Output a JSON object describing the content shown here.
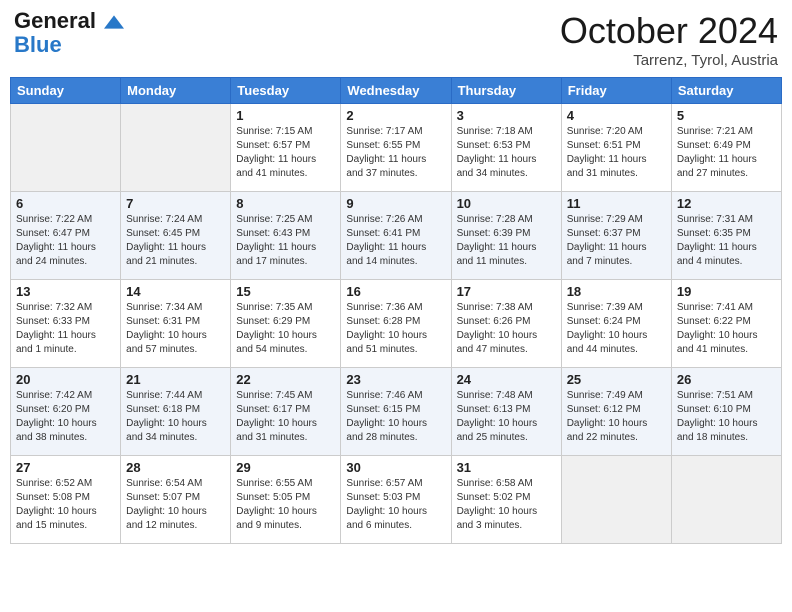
{
  "header": {
    "logo_general": "General",
    "logo_blue": "Blue",
    "month_title": "October 2024",
    "location": "Tarrenz, Tyrol, Austria"
  },
  "days_of_week": [
    "Sunday",
    "Monday",
    "Tuesday",
    "Wednesday",
    "Thursday",
    "Friday",
    "Saturday"
  ],
  "weeks": [
    [
      {
        "day": "",
        "info": ""
      },
      {
        "day": "",
        "info": ""
      },
      {
        "day": "1",
        "info": "Sunrise: 7:15 AM\nSunset: 6:57 PM\nDaylight: 11 hours and 41 minutes."
      },
      {
        "day": "2",
        "info": "Sunrise: 7:17 AM\nSunset: 6:55 PM\nDaylight: 11 hours and 37 minutes."
      },
      {
        "day": "3",
        "info": "Sunrise: 7:18 AM\nSunset: 6:53 PM\nDaylight: 11 hours and 34 minutes."
      },
      {
        "day": "4",
        "info": "Sunrise: 7:20 AM\nSunset: 6:51 PM\nDaylight: 11 hours and 31 minutes."
      },
      {
        "day": "5",
        "info": "Sunrise: 7:21 AM\nSunset: 6:49 PM\nDaylight: 11 hours and 27 minutes."
      }
    ],
    [
      {
        "day": "6",
        "info": "Sunrise: 7:22 AM\nSunset: 6:47 PM\nDaylight: 11 hours and 24 minutes."
      },
      {
        "day": "7",
        "info": "Sunrise: 7:24 AM\nSunset: 6:45 PM\nDaylight: 11 hours and 21 minutes."
      },
      {
        "day": "8",
        "info": "Sunrise: 7:25 AM\nSunset: 6:43 PM\nDaylight: 11 hours and 17 minutes."
      },
      {
        "day": "9",
        "info": "Sunrise: 7:26 AM\nSunset: 6:41 PM\nDaylight: 11 hours and 14 minutes."
      },
      {
        "day": "10",
        "info": "Sunrise: 7:28 AM\nSunset: 6:39 PM\nDaylight: 11 hours and 11 minutes."
      },
      {
        "day": "11",
        "info": "Sunrise: 7:29 AM\nSunset: 6:37 PM\nDaylight: 11 hours and 7 minutes."
      },
      {
        "day": "12",
        "info": "Sunrise: 7:31 AM\nSunset: 6:35 PM\nDaylight: 11 hours and 4 minutes."
      }
    ],
    [
      {
        "day": "13",
        "info": "Sunrise: 7:32 AM\nSunset: 6:33 PM\nDaylight: 11 hours and 1 minute."
      },
      {
        "day": "14",
        "info": "Sunrise: 7:34 AM\nSunset: 6:31 PM\nDaylight: 10 hours and 57 minutes."
      },
      {
        "day": "15",
        "info": "Sunrise: 7:35 AM\nSunset: 6:29 PM\nDaylight: 10 hours and 54 minutes."
      },
      {
        "day": "16",
        "info": "Sunrise: 7:36 AM\nSunset: 6:28 PM\nDaylight: 10 hours and 51 minutes."
      },
      {
        "day": "17",
        "info": "Sunrise: 7:38 AM\nSunset: 6:26 PM\nDaylight: 10 hours and 47 minutes."
      },
      {
        "day": "18",
        "info": "Sunrise: 7:39 AM\nSunset: 6:24 PM\nDaylight: 10 hours and 44 minutes."
      },
      {
        "day": "19",
        "info": "Sunrise: 7:41 AM\nSunset: 6:22 PM\nDaylight: 10 hours and 41 minutes."
      }
    ],
    [
      {
        "day": "20",
        "info": "Sunrise: 7:42 AM\nSunset: 6:20 PM\nDaylight: 10 hours and 38 minutes."
      },
      {
        "day": "21",
        "info": "Sunrise: 7:44 AM\nSunset: 6:18 PM\nDaylight: 10 hours and 34 minutes."
      },
      {
        "day": "22",
        "info": "Sunrise: 7:45 AM\nSunset: 6:17 PM\nDaylight: 10 hours and 31 minutes."
      },
      {
        "day": "23",
        "info": "Sunrise: 7:46 AM\nSunset: 6:15 PM\nDaylight: 10 hours and 28 minutes."
      },
      {
        "day": "24",
        "info": "Sunrise: 7:48 AM\nSunset: 6:13 PM\nDaylight: 10 hours and 25 minutes."
      },
      {
        "day": "25",
        "info": "Sunrise: 7:49 AM\nSunset: 6:12 PM\nDaylight: 10 hours and 22 minutes."
      },
      {
        "day": "26",
        "info": "Sunrise: 7:51 AM\nSunset: 6:10 PM\nDaylight: 10 hours and 18 minutes."
      }
    ],
    [
      {
        "day": "27",
        "info": "Sunrise: 6:52 AM\nSunset: 5:08 PM\nDaylight: 10 hours and 15 minutes."
      },
      {
        "day": "28",
        "info": "Sunrise: 6:54 AM\nSunset: 5:07 PM\nDaylight: 10 hours and 12 minutes."
      },
      {
        "day": "29",
        "info": "Sunrise: 6:55 AM\nSunset: 5:05 PM\nDaylight: 10 hours and 9 minutes."
      },
      {
        "day": "30",
        "info": "Sunrise: 6:57 AM\nSunset: 5:03 PM\nDaylight: 10 hours and 6 minutes."
      },
      {
        "day": "31",
        "info": "Sunrise: 6:58 AM\nSunset: 5:02 PM\nDaylight: 10 hours and 3 minutes."
      },
      {
        "day": "",
        "info": ""
      },
      {
        "day": "",
        "info": ""
      }
    ]
  ]
}
